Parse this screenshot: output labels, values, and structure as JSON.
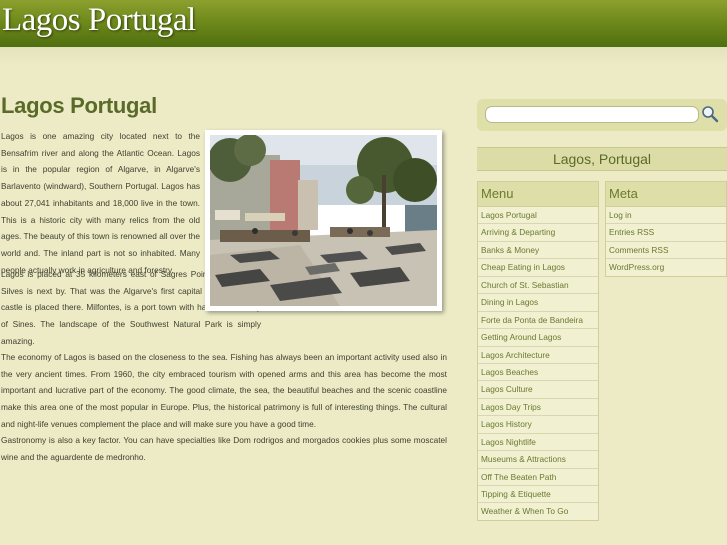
{
  "header": {
    "site_title": "Lagos Portugal"
  },
  "post": {
    "title": "Lagos Portugal",
    "paragraphs": [
      "Lagos is one amazing city located next to the Bensafrim river and along the Atlantic Ocean. Lagos is in the popular region of Algarve, in Algarve's Barlavento (windward), Southern Portugal. Lagos has about 27,041 inhabitants and 18,000 live in the town. This is a historic city with many relics from the old ages. The beauty of this town is renowned all over the world and. The inland part is not so inhabited. Many people actually work in agriculture and forestry.",
      "Lagos is placed at 35 kilometers east of Sagres Point. The road to Silves is next by. That was the Algarve's first capital and a Moorish castle is placed there. Milfontes, is a port town with harbor of the city of Sines. The landscape of the Southwest Natural Park is simply amazing.",
      "The economy of Lagos is based on the closeness to the sea. Fishing has always been an important activity used also in the very ancient times. From 1960, the city embraced tourism with opened arms and this area has become the most important and lucrative part of the economy. The good climate, the sea, the beautiful beaches and the scenic coastline make this area one of the most popular in Europe. Plus, the historical patrimony is full of interesting things. The cultural and night-life venues complement the place and will make sure you have a good time.",
      "Gastronomy is also a key factor. You can have specialties like Dom rodrigos and morgados cookies plus some moscatel wine and the aguardente de medronho."
    ]
  },
  "sidebar": {
    "search": {
      "placeholder": "",
      "icon": "search-icon"
    },
    "heading": "Lagos, Portugal",
    "menu": {
      "title": "Menu",
      "items": [
        "Lagos Portugal",
        "Arriving & Departing",
        "Banks & Money",
        "Cheap Eating in Lagos",
        "Church of St. Sebastian",
        "Dining in Lagos",
        "Forte da Ponta de Bandeira",
        "Getting Around Lagos",
        "Lagos Architecture",
        "Lagos Beaches",
        "Lagos Culture",
        "Lagos Day Trips",
        "Lagos History",
        "Lagos Nightlife",
        "Museums & Attractions",
        "Off The Beaten Path",
        "Tipping & Etiquette",
        "Weather & When To Go"
      ]
    },
    "meta": {
      "title": "Meta",
      "items": [
        "Log in",
        "Entries RSS",
        "Comments RSS",
        "WordPress.org"
      ]
    }
  },
  "colors": {
    "header_green": "#6f8a1c",
    "accent_green": "#5a6a28",
    "page_bg": "#ecebc6",
    "widget_title_bg": "#dedea8"
  }
}
